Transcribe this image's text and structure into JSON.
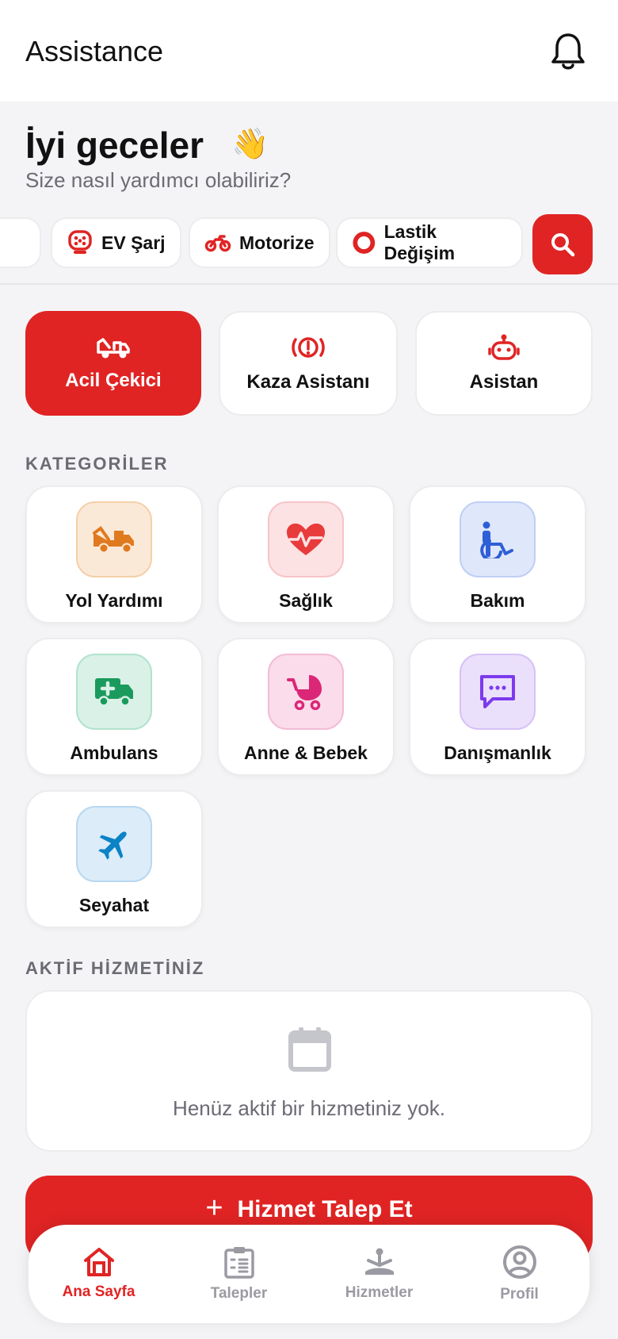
{
  "header": {
    "title": "Assistance",
    "notification_icon": "bell-icon"
  },
  "greeting": {
    "title": "İyi geceler",
    "emoji": "👋",
    "subtitle": "Size nasıl yardımcı olabiliriz?"
  },
  "chips": [
    {
      "label": "EV Şarj",
      "icon": "ev-charger-icon"
    },
    {
      "label": "Motorize",
      "icon": "motorcycle-icon"
    },
    {
      "label": "Lastik Değişim",
      "icon": "tire-icon"
    }
  ],
  "search_icon": "search-icon",
  "quick_actions": [
    {
      "label": "Acil Çekici",
      "icon": "tow-truck-icon"
    },
    {
      "label": "Kaza Asistanı",
      "icon": "alert-icon"
    },
    {
      "label": "Asistan",
      "icon": "robot-icon"
    }
  ],
  "categories": {
    "title": "KATEGORİLER",
    "items": [
      {
        "label": "Yol Yardımı",
        "icon": "tow-truck-icon"
      },
      {
        "label": "Sağlık",
        "icon": "heartbeat-icon"
      },
      {
        "label": "Bakım",
        "icon": "wheelchair-icon"
      },
      {
        "label": "Ambulans",
        "icon": "ambulance-icon"
      },
      {
        "label": "Anne & Bebek",
        "icon": "stroller-icon"
      },
      {
        "label": "Danışmanlık",
        "icon": "chat-icon"
      },
      {
        "label": "Seyahat",
        "icon": "airplane-icon"
      }
    ]
  },
  "active_service": {
    "title": "AKTİF HİZMETİNİZ",
    "empty_text": "Henüz aktif bir hizmetiniz yok."
  },
  "cta": {
    "plus": "+",
    "label": "Hizmet Talep Et"
  },
  "nav": [
    {
      "label": "Ana Sayfa",
      "icon": "home-icon",
      "active": true
    },
    {
      "label": "Talepler",
      "icon": "clipboard-icon",
      "active": false
    },
    {
      "label": "Hizmetler",
      "icon": "services-icon",
      "active": false
    },
    {
      "label": "Profil",
      "icon": "profile-icon",
      "active": false
    }
  ],
  "colors": {
    "accent": "#e02424",
    "muted": "#6b6b74",
    "nav_inactive": "#9a9aa2"
  }
}
